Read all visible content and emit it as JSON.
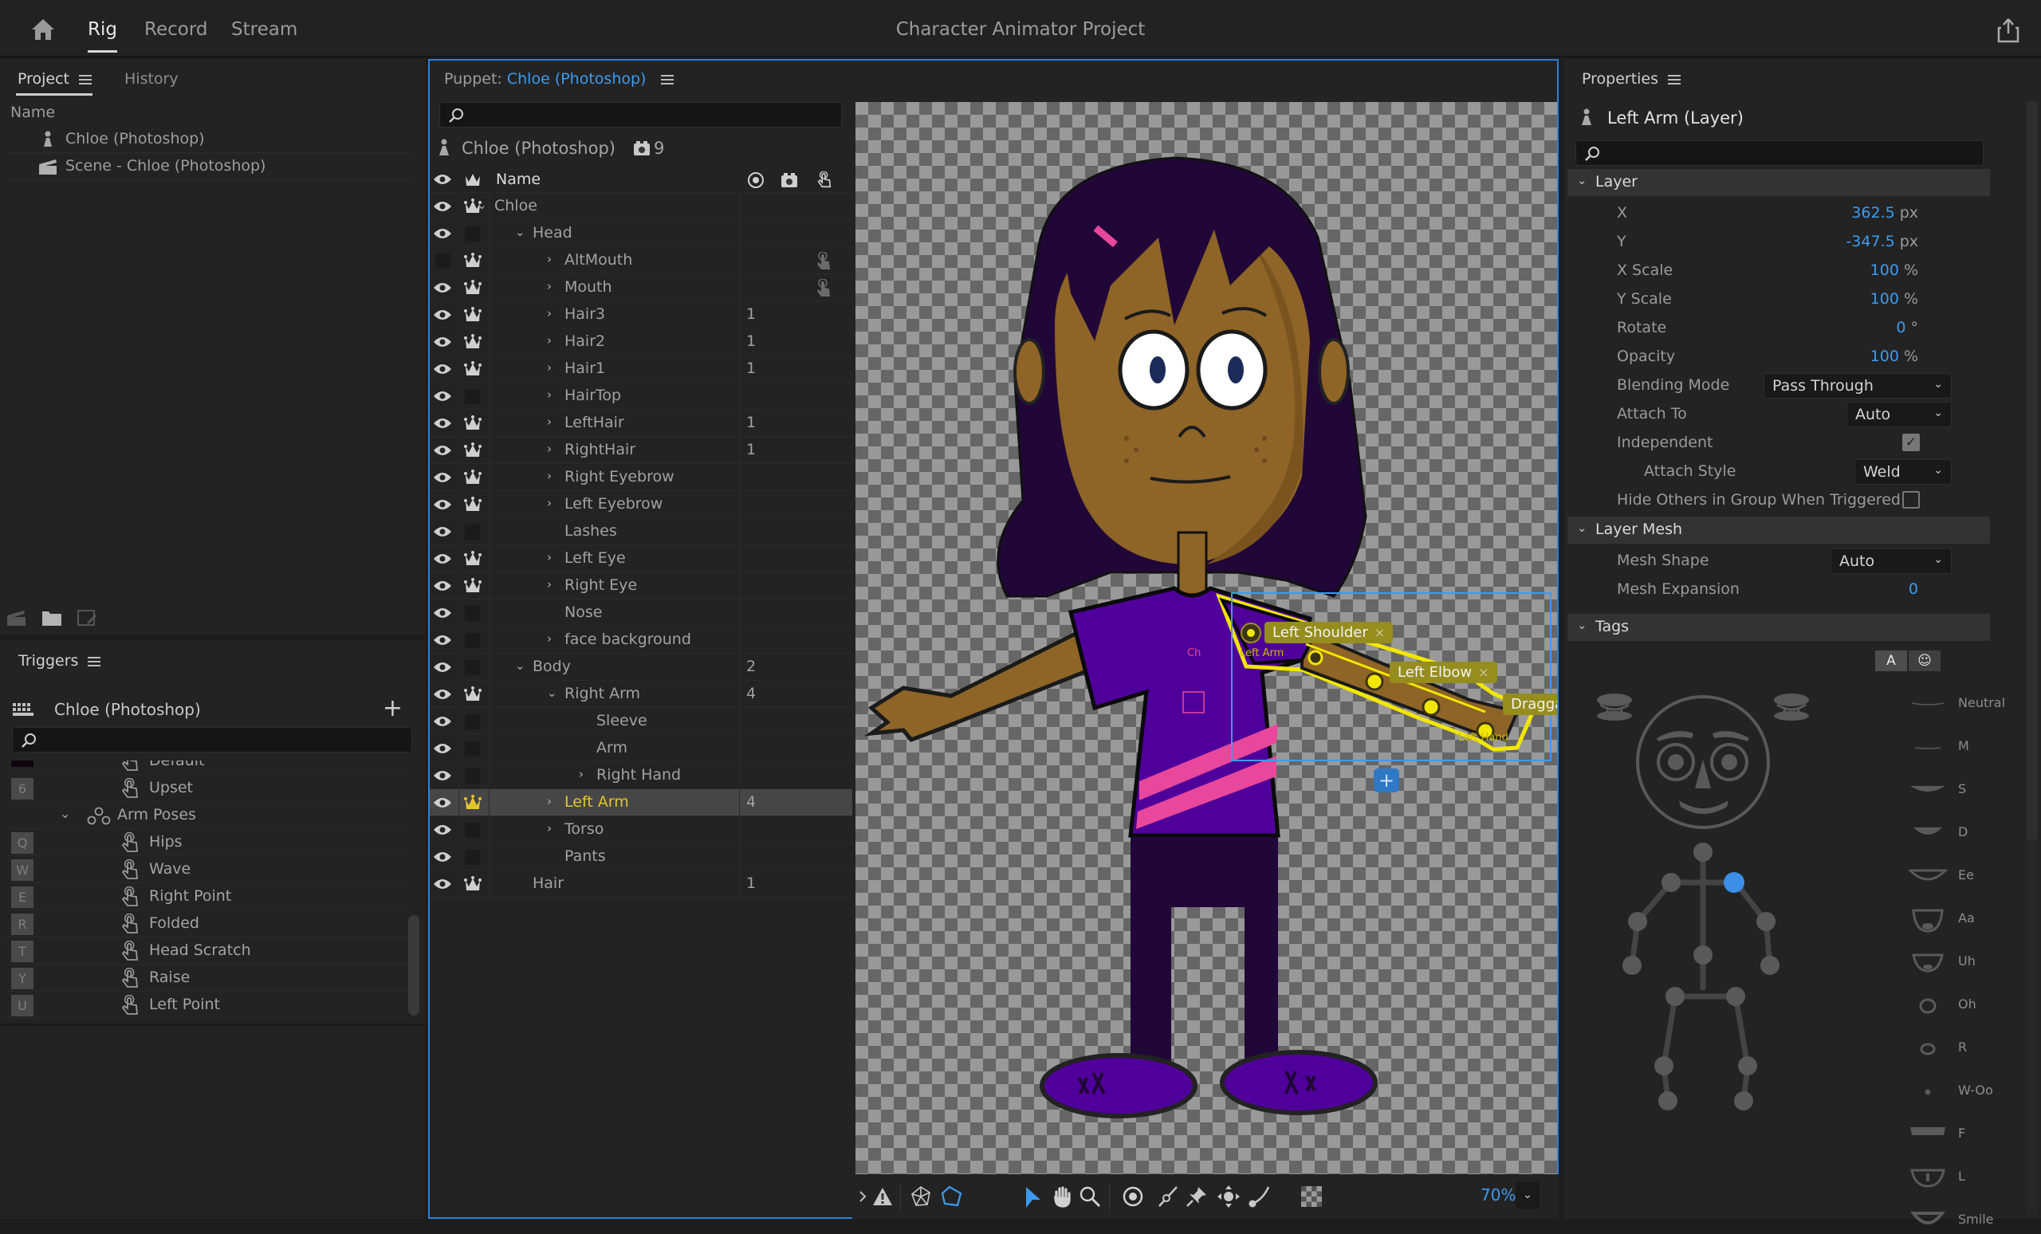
{
  "app": {
    "title": "Character Animator Project",
    "mode_tabs": [
      {
        "label": "Rig",
        "active": true
      },
      {
        "label": "Record",
        "active": false
      },
      {
        "label": "Stream",
        "active": false
      }
    ],
    "icons": {
      "home": "home-icon",
      "share": "share-icon"
    }
  },
  "project_panel": {
    "tabs": [
      {
        "label": "Project",
        "active": true
      },
      {
        "label": "History",
        "active": false
      }
    ],
    "column_header": "Name",
    "items": [
      {
        "label": "Chloe (Photoshop)",
        "icon": "puppet-icon"
      },
      {
        "label": "Scene - Chloe (Photoshop)",
        "icon": "scene-clapper-icon"
      }
    ],
    "footer_icons": [
      "new-scene-icon",
      "new-folder-icon",
      "edit-icon"
    ]
  },
  "triggers_panel": {
    "title": "Triggers",
    "puppet_name": "Chloe (Photoshop)",
    "search_placeholder": "",
    "items": [
      {
        "type": "trigger",
        "key": "",
        "label": "Default",
        "partial": true
      },
      {
        "type": "trigger",
        "key": "6",
        "label": "Upset"
      },
      {
        "type": "group",
        "label": "Arm Poses",
        "expanded": true
      },
      {
        "type": "trigger",
        "key": "Q",
        "label": "Hips"
      },
      {
        "type": "trigger",
        "key": "W",
        "label": "Wave"
      },
      {
        "type": "trigger",
        "key": "E",
        "label": "Right Point"
      },
      {
        "type": "trigger",
        "key": "R",
        "label": "Folded"
      },
      {
        "type": "trigger",
        "key": "T",
        "label": "Head Scratch"
      },
      {
        "type": "trigger",
        "key": "Y",
        "label": "Raise"
      },
      {
        "type": "trigger",
        "key": "U",
        "label": "Left Point"
      }
    ]
  },
  "puppet_panel": {
    "title_prefix": "Puppet:",
    "title_name": "Chloe (Photoshop)",
    "search_placeholder": "",
    "puppet_name": "Chloe (Photoshop)",
    "behavior_count": "9",
    "column_header": "Name",
    "layers": [
      {
        "name": "Chloe",
        "depth": 0,
        "expander": "open",
        "visible": true,
        "independent": true,
        "count": ""
      },
      {
        "name": "Head",
        "depth": 1,
        "expander": "open",
        "visible": true,
        "independent": false,
        "count": ""
      },
      {
        "name": "AltMouth",
        "depth": 2,
        "expander": "closed",
        "visible": false,
        "independent": true,
        "count": "",
        "trigger": true
      },
      {
        "name": "Mouth",
        "depth": 2,
        "expander": "closed",
        "visible": true,
        "independent": true,
        "count": "",
        "trigger": true
      },
      {
        "name": "Hair3",
        "depth": 2,
        "expander": "closed",
        "visible": true,
        "independent": true,
        "count": "1"
      },
      {
        "name": "Hair2",
        "depth": 2,
        "expander": "closed",
        "visible": true,
        "independent": true,
        "count": "1"
      },
      {
        "name": "Hair1",
        "depth": 2,
        "expander": "closed",
        "visible": true,
        "independent": true,
        "count": "1"
      },
      {
        "name": "HairTop",
        "depth": 2,
        "expander": "closed",
        "visible": true,
        "independent": false,
        "count": ""
      },
      {
        "name": "LeftHair",
        "depth": 2,
        "expander": "closed",
        "visible": true,
        "independent": true,
        "count": "1"
      },
      {
        "name": "RightHair",
        "depth": 2,
        "expander": "closed",
        "visible": true,
        "independent": true,
        "count": "1"
      },
      {
        "name": "Right Eyebrow",
        "depth": 2,
        "expander": "closed",
        "visible": true,
        "independent": true,
        "count": ""
      },
      {
        "name": "Left Eyebrow",
        "depth": 2,
        "expander": "closed",
        "visible": true,
        "independent": true,
        "count": ""
      },
      {
        "name": "Lashes",
        "depth": 2,
        "expander": "none",
        "visible": true,
        "independent": false,
        "count": ""
      },
      {
        "name": "Left Eye",
        "depth": 2,
        "expander": "closed",
        "visible": true,
        "independent": true,
        "count": ""
      },
      {
        "name": "Right Eye",
        "depth": 2,
        "expander": "closed",
        "visible": true,
        "independent": true,
        "count": ""
      },
      {
        "name": "Nose",
        "depth": 2,
        "expander": "none",
        "visible": true,
        "independent": false,
        "count": ""
      },
      {
        "name": "face background",
        "depth": 2,
        "expander": "closed",
        "visible": true,
        "independent": false,
        "count": ""
      },
      {
        "name": "Body",
        "depth": 1,
        "expander": "open",
        "visible": true,
        "independent": false,
        "count": "2"
      },
      {
        "name": "Right Arm",
        "depth": 2,
        "expander": "open",
        "visible": true,
        "independent": true,
        "count": "4"
      },
      {
        "name": "Sleeve",
        "depth": 3,
        "expander": "none",
        "visible": true,
        "independent": false,
        "count": ""
      },
      {
        "name": "Arm",
        "depth": 3,
        "expander": "none",
        "visible": true,
        "independent": false,
        "count": ""
      },
      {
        "name": "Right Hand",
        "depth": 3,
        "expander": "closed",
        "visible": true,
        "independent": false,
        "count": ""
      },
      {
        "name": "Left Arm",
        "depth": 2,
        "expander": "closed",
        "visible": true,
        "independent": true,
        "count": "4",
        "selected": true
      },
      {
        "name": "Torso",
        "depth": 2,
        "expander": "closed",
        "visible": true,
        "independent": false,
        "count": ""
      },
      {
        "name": "Pants",
        "depth": 2,
        "expander": "none",
        "visible": true,
        "independent": false,
        "count": ""
      },
      {
        "name": "Hair",
        "depth": 1,
        "expander": "none",
        "visible": true,
        "independent": true,
        "count": "1"
      }
    ],
    "canvas": {
      "handle_tags": [
        {
          "label": "Left Shoulder",
          "close": "×"
        },
        {
          "label": "Left Elbow",
          "close": "×"
        },
        {
          "label": "Draggat"
        }
      ],
      "handle_labels": [
        "Left Arm",
        "Left Hand"
      ],
      "origin_badge": "Ch",
      "add_handle": "+"
    },
    "toolbar": {
      "tools": [
        "expand-icon",
        "warning-icon",
        "mesh-icon",
        "outline-icon",
        "select-arrow-icon",
        "hand-pan-icon",
        "zoom-magnifier-icon",
        "origin-icon",
        "stick-icon",
        "pin-icon",
        "dragger-icon",
        "draw-icon",
        "transparency-grid-icon"
      ],
      "active_tool": "select-arrow-icon",
      "zoom": "70%"
    }
  },
  "properties_panel": {
    "title": "Properties",
    "selection": "Left Arm (Layer)",
    "search_placeholder": "",
    "sections": {
      "layer": {
        "label": "Layer",
        "x": {
          "label": "X",
          "value": "362.5",
          "unit": "px"
        },
        "y": {
          "label": "Y",
          "value": "-347.5",
          "unit": "px"
        },
        "x_scale": {
          "label": "X Scale",
          "value": "100",
          "unit": "%"
        },
        "y_scale": {
          "label": "Y Scale",
          "value": "100",
          "unit": "%"
        },
        "rotate": {
          "label": "Rotate",
          "value": "0",
          "unit": "°"
        },
        "opacity": {
          "label": "Opacity",
          "value": "100",
          "unit": "%"
        },
        "blending_mode": {
          "label": "Blending Mode",
          "value": "Pass Through"
        },
        "attach_to": {
          "label": "Attach To",
          "value": "Auto"
        },
        "independent": {
          "label": "Independent",
          "checked": true
        },
        "attach_style": {
          "label": "Attach Style",
          "value": "Weld"
        },
        "hide_others": {
          "label": "Hide Others in Group When Triggered",
          "checked": false
        }
      },
      "layer_mesh": {
        "label": "Layer Mesh",
        "mesh_shape": {
          "label": "Mesh Shape",
          "value": "Auto"
        },
        "mesh_expansion": {
          "label": "Mesh Expansion",
          "value": "0"
        }
      },
      "tags": {
        "label": "Tags",
        "toggle_text": "A",
        "toggle_face": "☺",
        "visemes": [
          "Neutral",
          "M",
          "S",
          "D",
          "Ee",
          "Aa",
          "Uh",
          "Oh",
          "R",
          "W-Oo",
          "F",
          "L",
          "Smile"
        ],
        "highlighted_body_tag": "Left Shoulder"
      }
    }
  },
  "colors": {
    "accent_blue": "#3c9bf0",
    "selection_yellow": "#e2c52a",
    "handle_tag_bg": "#958d1e",
    "panel_bg": "#232323"
  }
}
